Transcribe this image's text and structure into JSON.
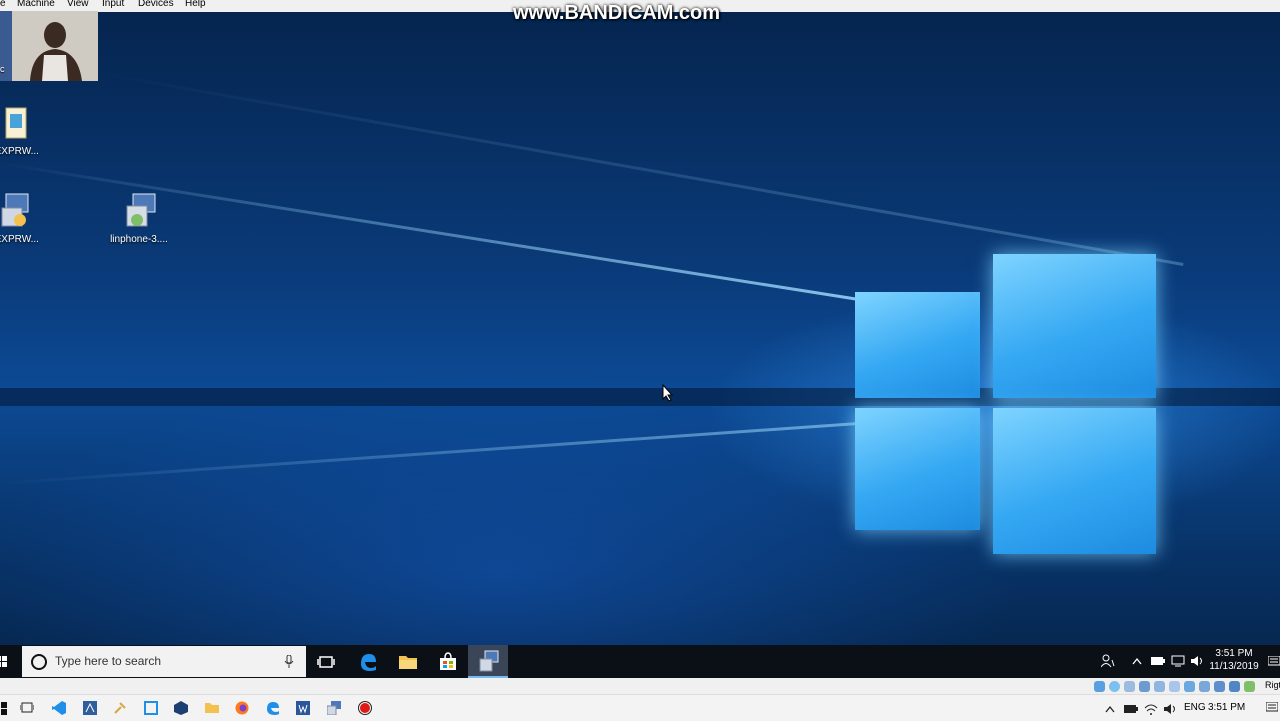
{
  "vbox_menu": {
    "items": [
      "e",
      "Machine",
      "View",
      "Input",
      "Devices",
      "Help"
    ]
  },
  "watermark": "www.BANDICAM.com",
  "desktop": {
    "icons": [
      {
        "label": "c",
        "icon": "folder-icon"
      },
      {
        "label": "LEXPRW...",
        "icon": "document-icon"
      },
      {
        "label": "LEXPRW...",
        "icon": "installer-icon"
      },
      {
        "label": "linphone-3....",
        "icon": "installer-icon"
      }
    ]
  },
  "taskbar": {
    "search_placeholder": "Type here to search",
    "apps": [
      "task-view-icon",
      "edge-icon",
      "file-explorer-icon",
      "store-icon",
      "installer-icon"
    ],
    "tray": {
      "time": "3:51 PM",
      "date": "11/13/2019"
    }
  },
  "vbox_status": {
    "host_key_label": "Rigt"
  },
  "host_taskbar": {
    "lang": "ENG",
    "time": "3:51 PM"
  },
  "colors": {
    "accent": "#1e90ff",
    "desktop_dark": "#05254f",
    "taskbar": "#0b0f16"
  }
}
